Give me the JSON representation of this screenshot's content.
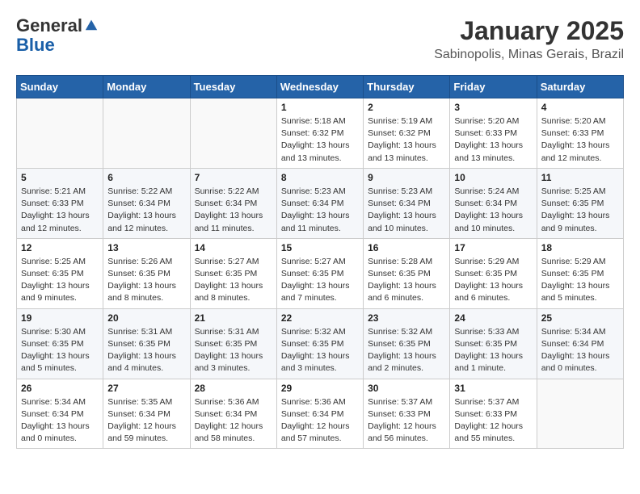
{
  "header": {
    "logo": {
      "line1": "General",
      "line2": "Blue"
    },
    "title": "January 2025",
    "subtitle": "Sabinopolis, Minas Gerais, Brazil"
  },
  "weekdays": [
    "Sunday",
    "Monday",
    "Tuesday",
    "Wednesday",
    "Thursday",
    "Friday",
    "Saturday"
  ],
  "weeks": [
    [
      {
        "day": "",
        "info": ""
      },
      {
        "day": "",
        "info": ""
      },
      {
        "day": "",
        "info": ""
      },
      {
        "day": "1",
        "info": "Sunrise: 5:18 AM\nSunset: 6:32 PM\nDaylight: 13 hours\nand 13 minutes."
      },
      {
        "day": "2",
        "info": "Sunrise: 5:19 AM\nSunset: 6:32 PM\nDaylight: 13 hours\nand 13 minutes."
      },
      {
        "day": "3",
        "info": "Sunrise: 5:20 AM\nSunset: 6:33 PM\nDaylight: 13 hours\nand 13 minutes."
      },
      {
        "day": "4",
        "info": "Sunrise: 5:20 AM\nSunset: 6:33 PM\nDaylight: 13 hours\nand 12 minutes."
      }
    ],
    [
      {
        "day": "5",
        "info": "Sunrise: 5:21 AM\nSunset: 6:33 PM\nDaylight: 13 hours\nand 12 minutes."
      },
      {
        "day": "6",
        "info": "Sunrise: 5:22 AM\nSunset: 6:34 PM\nDaylight: 13 hours\nand 12 minutes."
      },
      {
        "day": "7",
        "info": "Sunrise: 5:22 AM\nSunset: 6:34 PM\nDaylight: 13 hours\nand 11 minutes."
      },
      {
        "day": "8",
        "info": "Sunrise: 5:23 AM\nSunset: 6:34 PM\nDaylight: 13 hours\nand 11 minutes."
      },
      {
        "day": "9",
        "info": "Sunrise: 5:23 AM\nSunset: 6:34 PM\nDaylight: 13 hours\nand 10 minutes."
      },
      {
        "day": "10",
        "info": "Sunrise: 5:24 AM\nSunset: 6:34 PM\nDaylight: 13 hours\nand 10 minutes."
      },
      {
        "day": "11",
        "info": "Sunrise: 5:25 AM\nSunset: 6:35 PM\nDaylight: 13 hours\nand 9 minutes."
      }
    ],
    [
      {
        "day": "12",
        "info": "Sunrise: 5:25 AM\nSunset: 6:35 PM\nDaylight: 13 hours\nand 9 minutes."
      },
      {
        "day": "13",
        "info": "Sunrise: 5:26 AM\nSunset: 6:35 PM\nDaylight: 13 hours\nand 8 minutes."
      },
      {
        "day": "14",
        "info": "Sunrise: 5:27 AM\nSunset: 6:35 PM\nDaylight: 13 hours\nand 8 minutes."
      },
      {
        "day": "15",
        "info": "Sunrise: 5:27 AM\nSunset: 6:35 PM\nDaylight: 13 hours\nand 7 minutes."
      },
      {
        "day": "16",
        "info": "Sunrise: 5:28 AM\nSunset: 6:35 PM\nDaylight: 13 hours\nand 6 minutes."
      },
      {
        "day": "17",
        "info": "Sunrise: 5:29 AM\nSunset: 6:35 PM\nDaylight: 13 hours\nand 6 minutes."
      },
      {
        "day": "18",
        "info": "Sunrise: 5:29 AM\nSunset: 6:35 PM\nDaylight: 13 hours\nand 5 minutes."
      }
    ],
    [
      {
        "day": "19",
        "info": "Sunrise: 5:30 AM\nSunset: 6:35 PM\nDaylight: 13 hours\nand 5 minutes."
      },
      {
        "day": "20",
        "info": "Sunrise: 5:31 AM\nSunset: 6:35 PM\nDaylight: 13 hours\nand 4 minutes."
      },
      {
        "day": "21",
        "info": "Sunrise: 5:31 AM\nSunset: 6:35 PM\nDaylight: 13 hours\nand 3 minutes."
      },
      {
        "day": "22",
        "info": "Sunrise: 5:32 AM\nSunset: 6:35 PM\nDaylight: 13 hours\nand 3 minutes."
      },
      {
        "day": "23",
        "info": "Sunrise: 5:32 AM\nSunset: 6:35 PM\nDaylight: 13 hours\nand 2 minutes."
      },
      {
        "day": "24",
        "info": "Sunrise: 5:33 AM\nSunset: 6:35 PM\nDaylight: 13 hours\nand 1 minute."
      },
      {
        "day": "25",
        "info": "Sunrise: 5:34 AM\nSunset: 6:34 PM\nDaylight: 13 hours\nand 0 minutes."
      }
    ],
    [
      {
        "day": "26",
        "info": "Sunrise: 5:34 AM\nSunset: 6:34 PM\nDaylight: 13 hours\nand 0 minutes."
      },
      {
        "day": "27",
        "info": "Sunrise: 5:35 AM\nSunset: 6:34 PM\nDaylight: 12 hours\nand 59 minutes."
      },
      {
        "day": "28",
        "info": "Sunrise: 5:36 AM\nSunset: 6:34 PM\nDaylight: 12 hours\nand 58 minutes."
      },
      {
        "day": "29",
        "info": "Sunrise: 5:36 AM\nSunset: 6:34 PM\nDaylight: 12 hours\nand 57 minutes."
      },
      {
        "day": "30",
        "info": "Sunrise: 5:37 AM\nSunset: 6:33 PM\nDaylight: 12 hours\nand 56 minutes."
      },
      {
        "day": "31",
        "info": "Sunrise: 5:37 AM\nSunset: 6:33 PM\nDaylight: 12 hours\nand 55 minutes."
      },
      {
        "day": "",
        "info": ""
      }
    ]
  ]
}
